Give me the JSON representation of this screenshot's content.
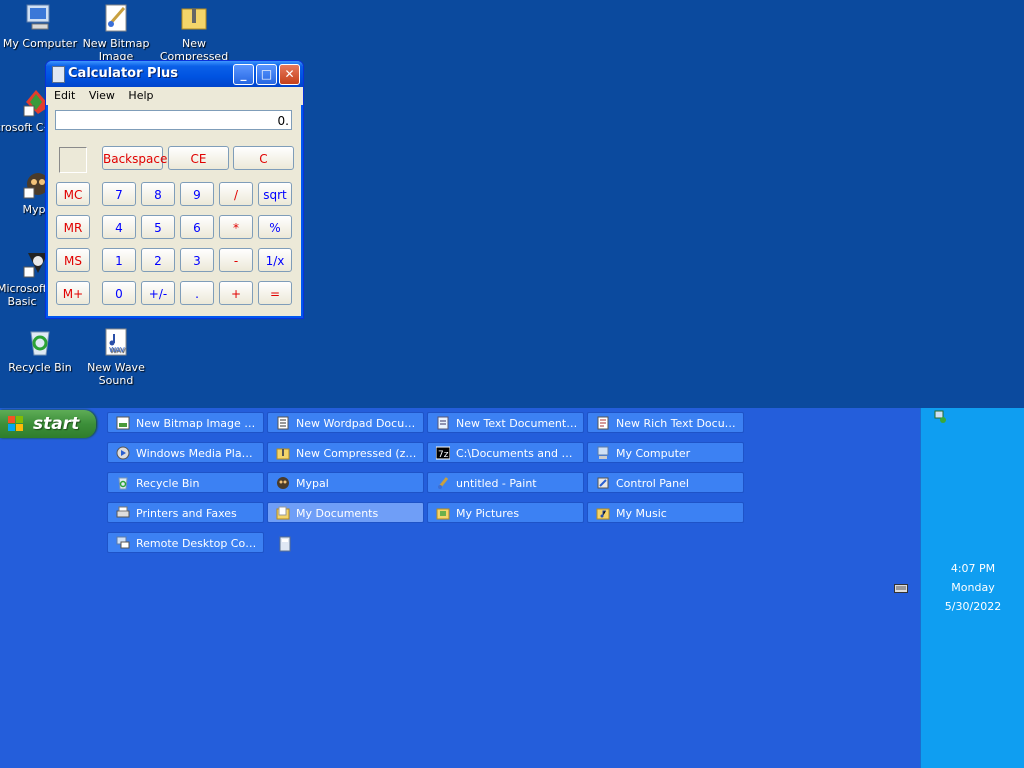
{
  "desktop": {
    "icons": {
      "my_computer": "My Computer",
      "new_bitmap": "New Bitmap Image",
      "new_compressed": "New Compressed",
      "ms_cpp": "Microsoft C++",
      "mypal": "Myp",
      "ms_basic": "Microsoft Basic",
      "recycle_bin": "Recycle Bin",
      "new_wave": "New Wave Sound"
    }
  },
  "calculator": {
    "title": "Calculator Plus",
    "menu": [
      "Edit",
      "View",
      "Help"
    ],
    "display": "0.",
    "buttons": {
      "backspace": "Backspace",
      "ce": "CE",
      "c": "C",
      "mc": "MC",
      "mr": "MR",
      "ms": "MS",
      "mplus": "M+",
      "n7": "7",
      "n8": "8",
      "n9": "9",
      "div": "/",
      "sqrt": "sqrt",
      "n4": "4",
      "n5": "5",
      "n6": "6",
      "mul": "*",
      "pct": "%",
      "n1": "1",
      "n2": "2",
      "n3": "3",
      "sub": "-",
      "inv": "1/x",
      "n0": "0",
      "sign": "+/-",
      "dot": ".",
      "add": "+",
      "eq": "="
    }
  },
  "taskbar": {
    "start": "start",
    "tasks": [
      {
        "label": "New Bitmap Image - ..."
      },
      {
        "label": "New Wordpad Docum..."
      },
      {
        "label": "New Text Document -..."
      },
      {
        "label": "New Rich Text Docum..."
      },
      {
        "label": "Windows Media Player"
      },
      {
        "label": "New Compressed (zip..."
      },
      {
        "label": "C:\\Documents and Se..."
      },
      {
        "label": "My Computer"
      },
      {
        "label": "Recycle Bin"
      },
      {
        "label": "Mypal"
      },
      {
        "label": "untitled - Paint"
      },
      {
        "label": "Control Panel"
      },
      {
        "label": "Printers and Faxes"
      },
      {
        "label": "My Documents"
      },
      {
        "label": "My Pictures"
      },
      {
        "label": "My Music"
      },
      {
        "label": "Remote Desktop Con..."
      }
    ]
  },
  "tray": {
    "time": "4:07 PM",
    "day": "Monday",
    "date": "5/30/2022"
  }
}
